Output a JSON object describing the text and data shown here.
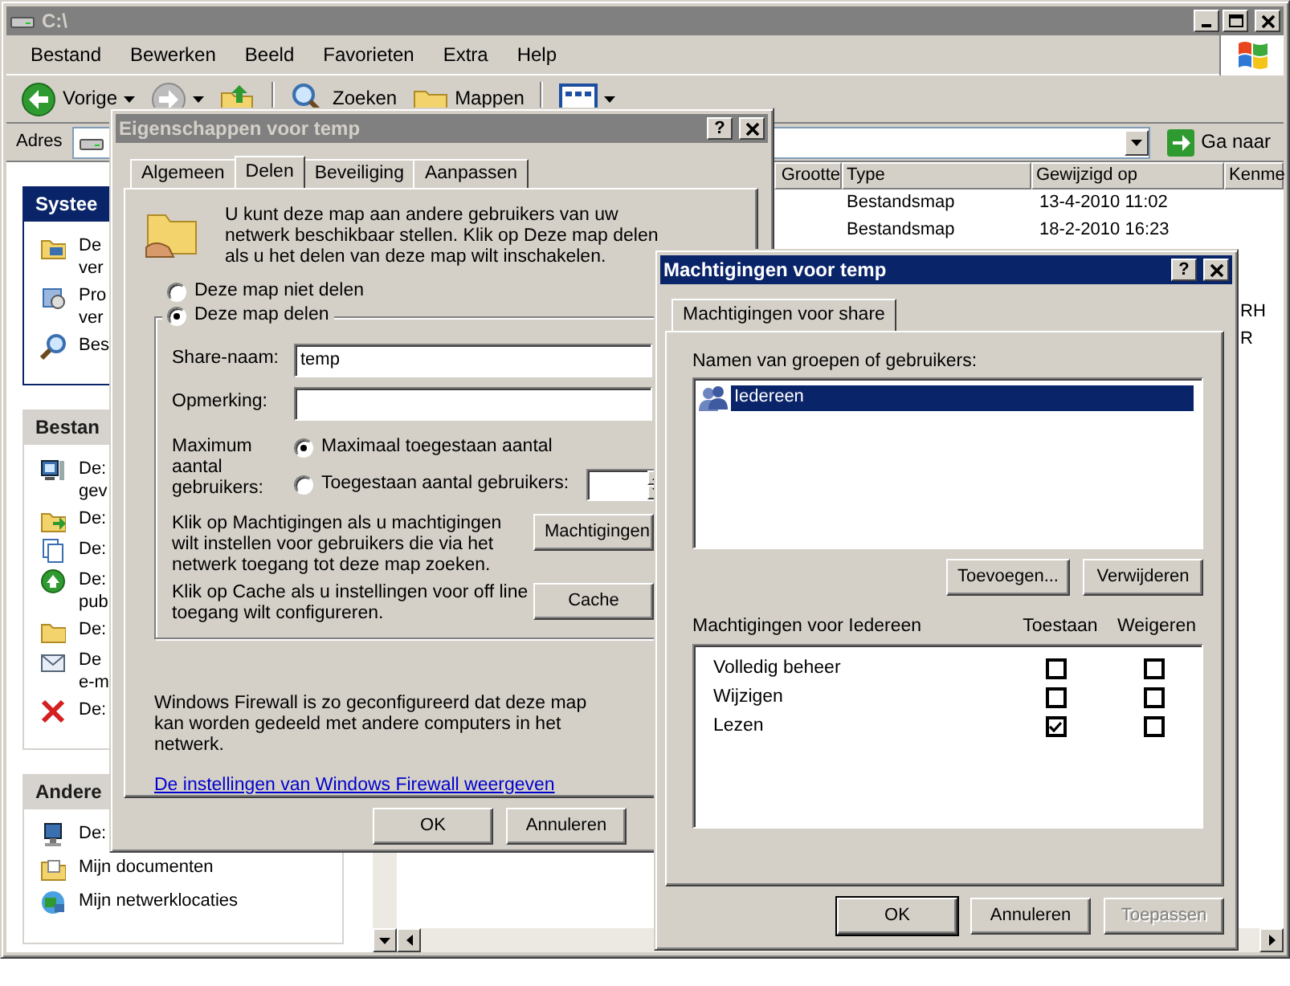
{
  "explorer": {
    "title": "C:\\",
    "active": false,
    "menu": [
      "Bestand",
      "Bewerken",
      "Beeld",
      "Favorieten",
      "Extra",
      "Help"
    ],
    "toolbar": [
      {
        "kind": "back",
        "label": "Vorige"
      },
      {
        "kind": "forward"
      },
      {
        "kind": "up"
      },
      {
        "kind": "search",
        "label": "Zoeken"
      },
      {
        "kind": "folders",
        "label": "Mappen"
      },
      {
        "kind": "views"
      }
    ],
    "address": {
      "label": "Adres",
      "go": "Ga naar"
    },
    "task_panels": [
      {
        "title": "Systee",
        "kind": "special",
        "items": [
          {
            "kind": "system-info",
            "lines": [
              "De",
              "ver"
            ]
          },
          {
            "kind": "programs",
            "lines": [
              "Pro",
              "ver"
            ]
          },
          {
            "kind": "search",
            "lines": [
              "Bes"
            ]
          }
        ]
      },
      {
        "title": "Bestan",
        "kind": "normal",
        "items": [
          {
            "kind": "publish",
            "lines": [
              "De:",
              "gev"
            ]
          },
          {
            "kind": "move",
            "lines": [
              "De:"
            ]
          },
          {
            "kind": "copy",
            "lines": [
              "De:"
            ]
          },
          {
            "kind": "web",
            "lines": [
              "De:",
              "pub"
            ]
          },
          {
            "kind": "folder",
            "lines": [
              "De:"
            ]
          },
          {
            "kind": "mail",
            "lines": [
              "De",
              "e-m"
            ]
          },
          {
            "kind": "delete",
            "lines": [
              "De:"
            ]
          }
        ]
      },
      {
        "title": "Andere",
        "kind": "normal",
        "items": [
          {
            "kind": "computer",
            "lines": [
              "De:"
            ]
          },
          {
            "kind": "documents",
            "lines": [
              "Mijn documenten"
            ]
          },
          {
            "kind": "network",
            "lines": [
              "Mijn netwerklocaties"
            ]
          }
        ]
      }
    ],
    "columns": [
      "Grootte",
      "Type",
      "Gewijzigd op",
      "Kenme"
    ],
    "rows": [
      {
        "type": "Bestandsmap",
        "modified": "13-4-2010 11:02"
      },
      {
        "type": "Bestandsmap",
        "modified": "18-2-2010 16:23"
      }
    ],
    "attribute_rows": [
      "RH",
      "R"
    ]
  },
  "properties_dialog": {
    "title": "Eigenschappen voor temp",
    "active": false,
    "help_button": "?",
    "tabs": [
      {
        "label": "Algemeen",
        "selected": false
      },
      {
        "label": "Delen",
        "selected": true
      },
      {
        "label": "Beveiliging",
        "selected": false
      },
      {
        "label": "Aanpassen",
        "selected": false
      }
    ],
    "intro": "U kunt deze map aan andere gebruikers van uw netwerk beschikbaar stellen. Klik op Deze map delen als u het delen van deze map wilt inschakelen.",
    "share_options": [
      {
        "label": "Deze map niet delen",
        "selected": false
      },
      {
        "label": "Deze map delen",
        "selected": true
      }
    ],
    "share_name": {
      "label": "Share-naam:",
      "value": "temp"
    },
    "comment": {
      "label": "Opmerking:"
    },
    "max_users": {
      "label": "Maximum aantal gebruikers:",
      "options": [
        {
          "label": "Maximaal toegestaan aantal",
          "selected": true
        },
        {
          "label": "Toegestaan aantal gebruikers:",
          "selected": false
        }
      ]
    },
    "permissions_text": "Klik op Machtigingen als u machtigingen wilt instellen voor gebruikers die via het netwerk toegang tot deze map zoeken.",
    "permissions_button": "Machtigingen",
    "cache_text": "Klik op Cache als u instellingen voor off line toegang wilt configureren.",
    "cache_button": "Cache",
    "firewall_text": "Windows Firewall is zo geconfigureerd dat deze map kan worden gedeeld met andere computers in het netwerk.",
    "firewall_link": "De instellingen van Windows Firewall weergeven",
    "buttons": [
      {
        "label": "OK",
        "default": false,
        "disabled": false
      },
      {
        "label": "Annuleren",
        "default": false,
        "disabled": false
      }
    ]
  },
  "permissions_dialog": {
    "title": "Machtigingen voor temp",
    "active": true,
    "help_button": "?",
    "tabs": [
      {
        "label": "Machtigingen voor share",
        "selected": true
      }
    ],
    "users_label": "Namen van groepen of gebruikers:",
    "users": [
      {
        "name": "Iedereen",
        "selected": true
      }
    ],
    "add_button": "Toevoegen...",
    "remove_button": "Verwijderen",
    "permissions_label": "Machtigingen voor Iedereen",
    "allow_header": "Toestaan",
    "deny_header": "Weigeren",
    "permissions": [
      {
        "name": "Volledig beheer",
        "allow": false,
        "deny": false
      },
      {
        "name": "Wijzigen",
        "allow": false,
        "deny": false
      },
      {
        "name": "Lezen",
        "allow": true,
        "deny": false
      }
    ],
    "buttons": [
      {
        "label": "OK",
        "default": true,
        "disabled": false
      },
      {
        "label": "Annuleren",
        "default": false,
        "disabled": false
      },
      {
        "label": "Toepassen",
        "default": false,
        "disabled": true
      }
    ]
  }
}
